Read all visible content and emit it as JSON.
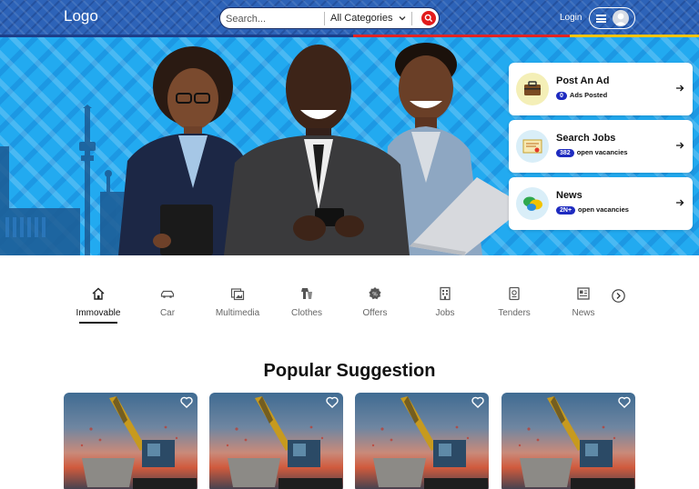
{
  "header": {
    "logo": "Logo",
    "search_placeholder": "Search...",
    "category_select": "All Categories",
    "login_label": "Login"
  },
  "hero_cards": [
    {
      "title": "Post An Ad",
      "badge": "0",
      "subtitle": "Ads Posted",
      "icon": "briefcase-icon"
    },
    {
      "title": "Search Jobs",
      "badge": "382",
      "subtitle": "open vacancies",
      "icon": "certificate-icon"
    },
    {
      "title": "News",
      "badge": "2N+",
      "subtitle": "open vacancies",
      "icon": "chat-bubbles-icon"
    }
  ],
  "categories": [
    {
      "label": "Immovable",
      "icon": "home-icon",
      "active": true
    },
    {
      "label": "Car",
      "icon": "car-icon"
    },
    {
      "label": "Multimedia",
      "icon": "multimedia-icon"
    },
    {
      "label": "Clothes",
      "icon": "clothes-icon"
    },
    {
      "label": "Offers",
      "icon": "offer-badge-icon"
    },
    {
      "label": "Jobs",
      "icon": "building-icon"
    },
    {
      "label": "Tenders",
      "icon": "tender-document-icon"
    },
    {
      "label": "News",
      "icon": "newspaper-icon"
    }
  ],
  "popular": {
    "title": "Popular Suggestion",
    "items": [
      {
        "image": "excavator-photo"
      },
      {
        "image": "excavator-photo"
      },
      {
        "image": "excavator-photo"
      },
      {
        "image": "excavator-photo"
      }
    ]
  },
  "colors": {
    "header_bg": "#2d63b8",
    "hero_bg": "#22aaf0",
    "search_button": "#e21b1b",
    "badge": "#1e2bc0"
  }
}
